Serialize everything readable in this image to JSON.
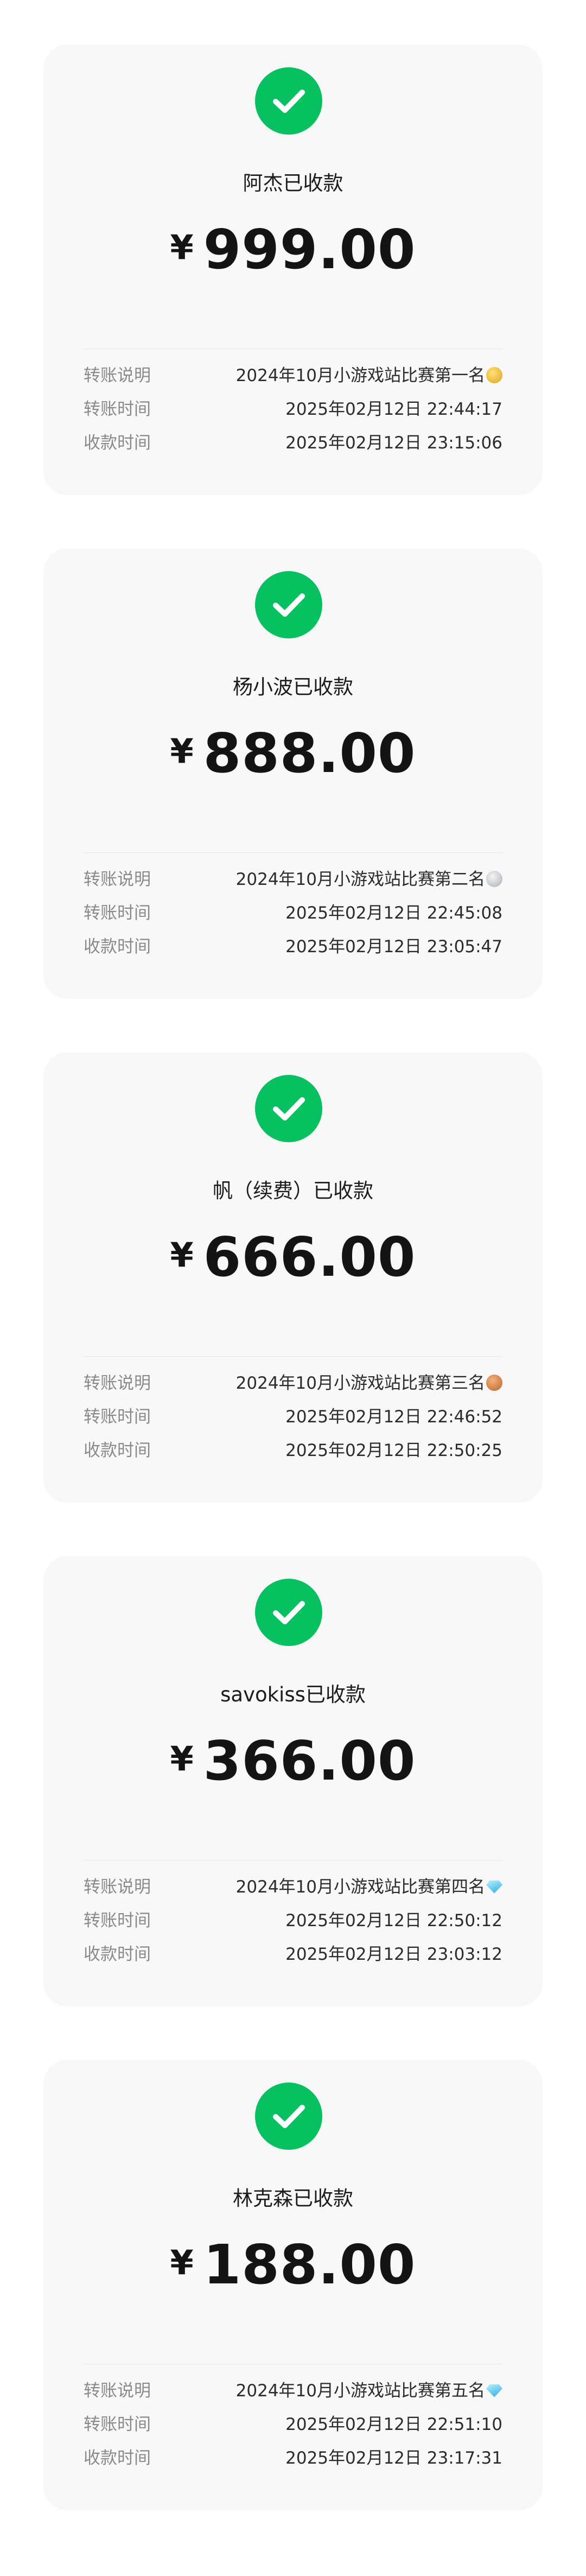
{
  "labels": {
    "note": "转账说明",
    "transfer_time": "转账时间",
    "receive_time": "收款时间"
  },
  "colors": {
    "success": "#07c160",
    "card_bg": "#f8f8f8",
    "label": "#8a8a8a"
  },
  "receipts": [
    {
      "status": "阿杰已收款",
      "currency": "¥",
      "amount": "999.00",
      "note": "2024年10月小游戏站比赛第一名",
      "note_icon": "gold-medal-icon",
      "transfer_time": "2025年02月12日 22:44:17",
      "receive_time": "2025年02月12日 23:15:06"
    },
    {
      "status": "杨小波已收款",
      "currency": "¥",
      "amount": "888.00",
      "note": "2024年10月小游戏站比赛第二名",
      "note_icon": "silver-medal-icon",
      "transfer_time": "2025年02月12日 22:45:08",
      "receive_time": "2025年02月12日 23:05:47"
    },
    {
      "status": "帆（续费）已收款",
      "currency": "¥",
      "amount": "666.00",
      "note": "2024年10月小游戏站比赛第三名",
      "note_icon": "bronze-medal-icon",
      "transfer_time": "2025年02月12日 22:46:52",
      "receive_time": "2025年02月12日 22:50:25"
    },
    {
      "status": "savokiss已收款",
      "currency": "¥",
      "amount": "366.00",
      "note": "2024年10月小游戏站比赛第四名",
      "note_icon": "diamond-icon",
      "transfer_time": "2025年02月12日 22:50:12",
      "receive_time": "2025年02月12日 23:03:12"
    },
    {
      "status": "林克森已收款",
      "currency": "¥",
      "amount": "188.00",
      "note": "2024年10月小游戏站比赛第五名",
      "note_icon": "diamond-icon",
      "transfer_time": "2025年02月12日 22:51:10",
      "receive_time": "2025年02月12日 23:17:31"
    }
  ]
}
